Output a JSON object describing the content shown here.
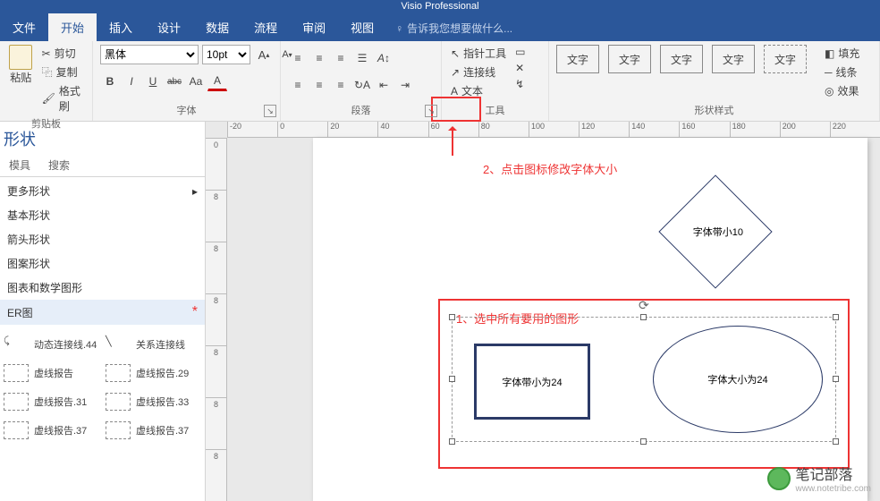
{
  "titlebar": "Visio Professional",
  "tabs": {
    "file": "文件",
    "home": "开始",
    "insert": "插入",
    "design": "设计",
    "data": "数据",
    "process": "流程",
    "review": "审阅",
    "view": "视图",
    "tellme": "告诉我您想要做什么..."
  },
  "clipboard": {
    "paste": "粘贴",
    "cut": "剪切",
    "copy": "复制",
    "painter": "格式刷",
    "label": "剪贴板"
  },
  "font": {
    "name": "黑体",
    "size": "10pt",
    "bold": "B",
    "italic": "I",
    "underline": "U",
    "strike": "abc",
    "case": "Aa",
    "color": "A",
    "grow": "A^",
    "shrink": "A˅",
    "label": "字体"
  },
  "paragraph": {
    "label": "段落"
  },
  "tools": {
    "pointer": "指针工具",
    "connector": "连接线",
    "text": "文本",
    "label": "工具"
  },
  "shapestyle": {
    "text": "文字",
    "label": "形状样式",
    "fill": "填充",
    "line": "线条",
    "effects": "效果"
  },
  "sidepanel": {
    "title": "形状",
    "tab_stencil": "模具",
    "tab_search": "搜索",
    "items": [
      "更多形状",
      "基本形状",
      "箭头形状",
      "图案形状",
      "图表和数学图形",
      "ER图"
    ],
    "stencils": {
      "dyn": "动态连接线.44",
      "rel": "关系连接线",
      "r1": "虚线报告",
      "r2": "虚线报告.29",
      "r3": "虚线报告.31",
      "r4": "虚线报告.33",
      "r5": "虚线报告.37",
      "r6": "虚线报告.37"
    }
  },
  "ruler_h": [
    "-20",
    "0",
    "20",
    "40",
    "60",
    "80",
    "100",
    "120",
    "140",
    "160",
    "180",
    "200",
    "220"
  ],
  "ruler_v": [
    "0",
    "8",
    "8",
    "8",
    "8",
    "8",
    "8"
  ],
  "annotations": {
    "step1": "1、选中所有要用的图形",
    "step2": "2、点击图标修改字体大小"
  },
  "canvas": {
    "diamond": "字体带小10",
    "rect": "字体带小为24",
    "ellipse": "字体大小为24"
  },
  "watermark": {
    "text": "笔记部落",
    "url": "www.notetribe.com"
  }
}
